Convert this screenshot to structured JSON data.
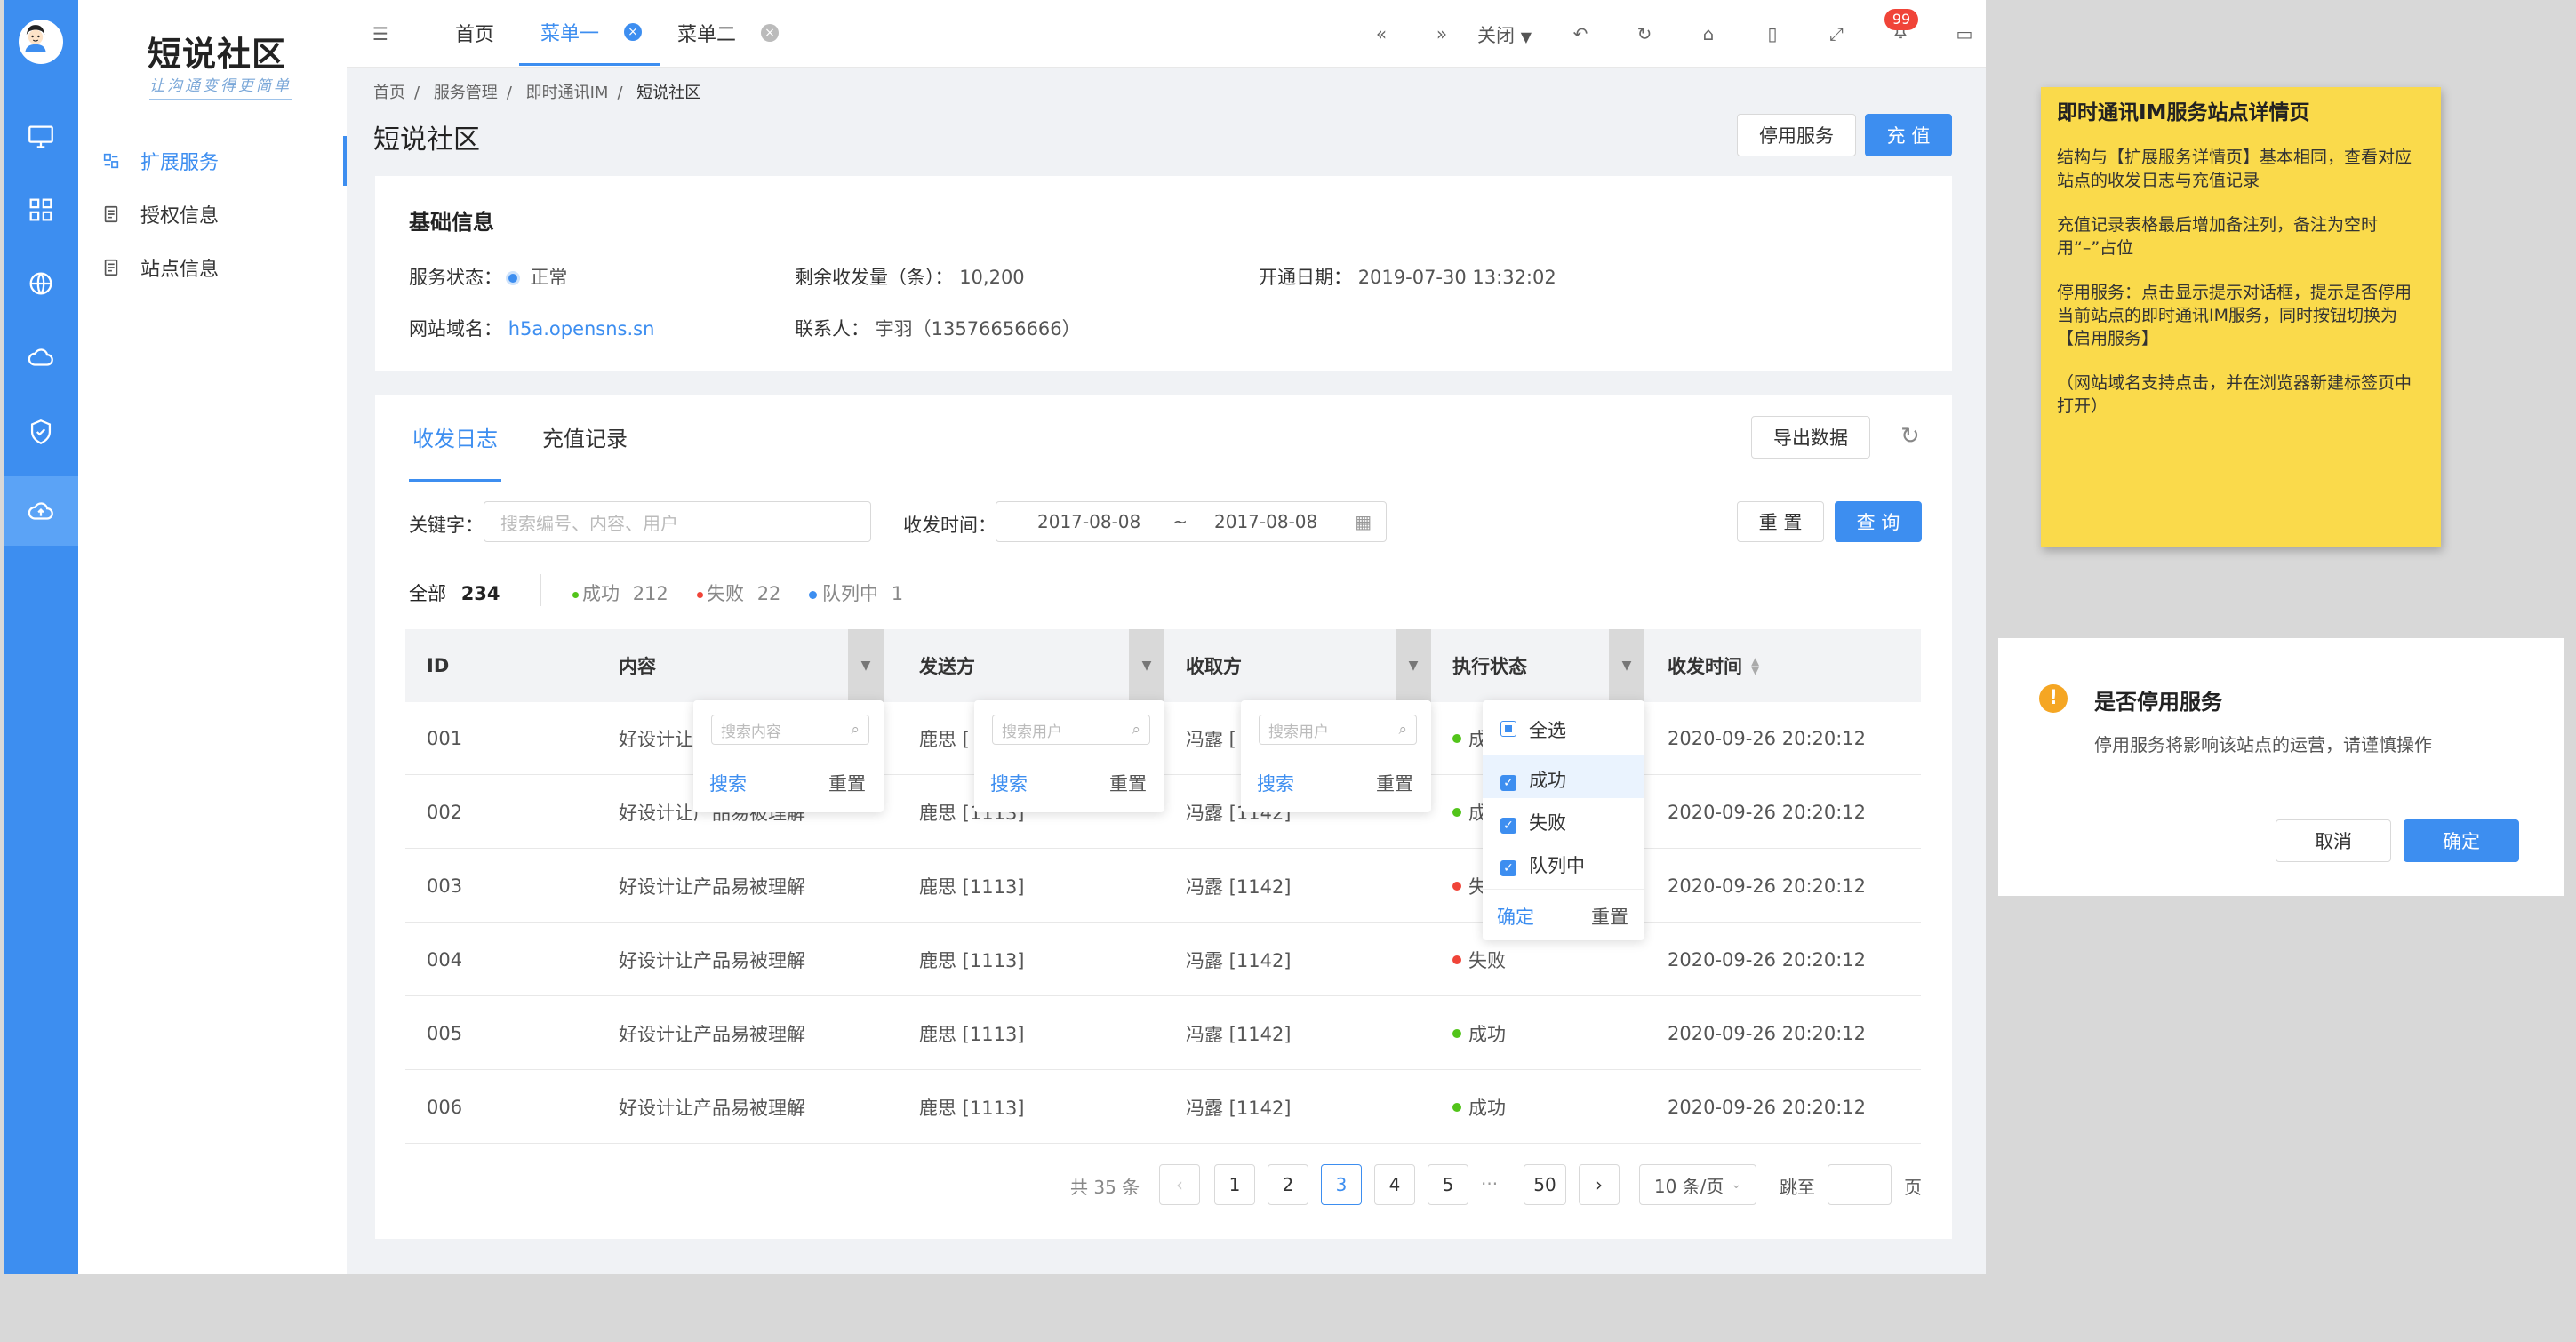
{
  "sidebar": {
    "logo": "短说社区",
    "slogan": "让沟通变得更简单",
    "items": [
      {
        "label": "扩展服务",
        "active": true
      },
      {
        "label": "授权信息",
        "active": false
      },
      {
        "label": "站点信息",
        "active": false
      }
    ],
    "rail_icons": [
      "monitor-icon",
      "grid-icon",
      "globe-icon",
      "cloud-icon",
      "shield-icon",
      "cloud-upload-icon"
    ]
  },
  "topbar": {
    "tabs": [
      {
        "label": "首页"
      },
      {
        "label": "菜单一",
        "active": true
      },
      {
        "label": "菜单二"
      }
    ],
    "close_label": "关闭",
    "badge": "99"
  },
  "breadcrumb": [
    "首页",
    "服务管理",
    "即时通讯IM",
    "短说社区"
  ],
  "page": {
    "title": "短说社区",
    "stop_button": "停用服务",
    "recharge_button": "充 值"
  },
  "basic": {
    "title": "基础信息",
    "status_label": "服务状态：",
    "status_value": "正常",
    "remaining_label": "剩余收发量（条）：",
    "remaining_value": "10,200",
    "open_date_label": "开通日期：",
    "open_date_value": "2019-07-30 13:32:02",
    "domain_label": "网站域名：",
    "domain_value": "h5a.opensns.sn",
    "contact_label": "联系人：",
    "contact_value": "宇羽（13576656666）"
  },
  "logs": {
    "tabs": [
      "收发日志",
      "充值记录"
    ],
    "export_button": "导出数据",
    "keyword_label": "关键字：",
    "keyword_placeholder": "搜索编号、内容、用户",
    "time_label": "收发时间：",
    "date_from": "2017-08-08",
    "date_sep": "~",
    "date_to": "2017-08-08",
    "reset_button": "重 置",
    "query_button": "查 询",
    "summary": {
      "all_label": "全部",
      "all_count": "234",
      "success_label": "成功",
      "success_count": "212",
      "fail_label": "失败",
      "fail_count": "22",
      "queue_label": "队列中",
      "queue_count": "1"
    },
    "columns": [
      "ID",
      "内容",
      "发送方",
      "收取方",
      "执行状态",
      "收发时间"
    ],
    "rows": [
      {
        "id": "001",
        "content": "好设计让",
        "sender": "鹿思 [",
        "receiver": "冯露 [",
        "status": "成",
        "status_color": "#52c41a",
        "time": "2020-09-26 20:20:12"
      },
      {
        "id": "002",
        "content": "好设计让产品易被理解",
        "sender": "鹿思 [1113]",
        "receiver": "冯露 [1142]",
        "status": "成",
        "status_color": "#52c41a",
        "time": "2020-09-26 20:20:12"
      },
      {
        "id": "003",
        "content": "好设计让产品易被理解",
        "sender": "鹿思 [1113]",
        "receiver": "冯露 [1142]",
        "status": "失",
        "status_color": "#f04438",
        "time": "2020-09-26 20:20:12"
      },
      {
        "id": "004",
        "content": "好设计让产品易被理解",
        "sender": "鹿思 [1113]",
        "receiver": "冯露 [1142]",
        "status": "失败",
        "status_color": "#f04438",
        "time": "2020-09-26 20:20:12"
      },
      {
        "id": "005",
        "content": "好设计让产品易被理解",
        "sender": "鹿思 [1113]",
        "receiver": "冯露 [1142]",
        "status": "成功",
        "status_color": "#52c41a",
        "time": "2020-09-26 20:20:12"
      },
      {
        "id": "006",
        "content": "好设计让产品易被理解",
        "sender": "鹿思 [1113]",
        "receiver": "冯露 [1142]",
        "status": "成功",
        "status_color": "#52c41a",
        "time": "2020-09-26 20:20:12"
      }
    ],
    "filter_content": {
      "placeholder": "搜索内容",
      "search": "搜索",
      "reset": "重置"
    },
    "filter_sender": {
      "placeholder": "搜索用户",
      "search": "搜索",
      "reset": "重置"
    },
    "filter_receiver": {
      "placeholder": "搜索用户",
      "search": "搜索",
      "reset": "重置"
    },
    "filter_status": {
      "select_all": "全选",
      "options": [
        "成功",
        "失败",
        "队列中"
      ],
      "confirm": "确定",
      "reset": "重置"
    }
  },
  "pagination": {
    "total": "共 35 条",
    "pages": [
      "1",
      "2",
      "3",
      "4",
      "5"
    ],
    "ellipsis": "···",
    "last": "50",
    "current": "3",
    "page_size": "10 条/页",
    "jump_label": "跳至",
    "page_unit": "页"
  },
  "note": {
    "title": "即时通讯IM服务站点详情页",
    "paragraphs": [
      "结构与【扩展服务详情页】基本相同，查看对应站点的收发日志与充值记录",
      "充值记录表格最后增加备注列，备注为空时用“–”占位",
      "停用服务：点击显示提示对话框，提示是否停用当前站点的即时通讯IM服务，同时按钮切换为【启用服务】",
      "（网站域名支持点击，并在浏览器新建标签页中打开）"
    ]
  },
  "dialog": {
    "title": "是否停用服务",
    "message": "停用服务将影响该站点的运营，请谨慎操作",
    "cancel": "取消",
    "confirm": "确定"
  },
  "colors": {
    "primary": "#3d8ef0",
    "success": "#52c41a",
    "danger": "#f04438",
    "warning": "#f5a623",
    "note": "#fada4b"
  }
}
